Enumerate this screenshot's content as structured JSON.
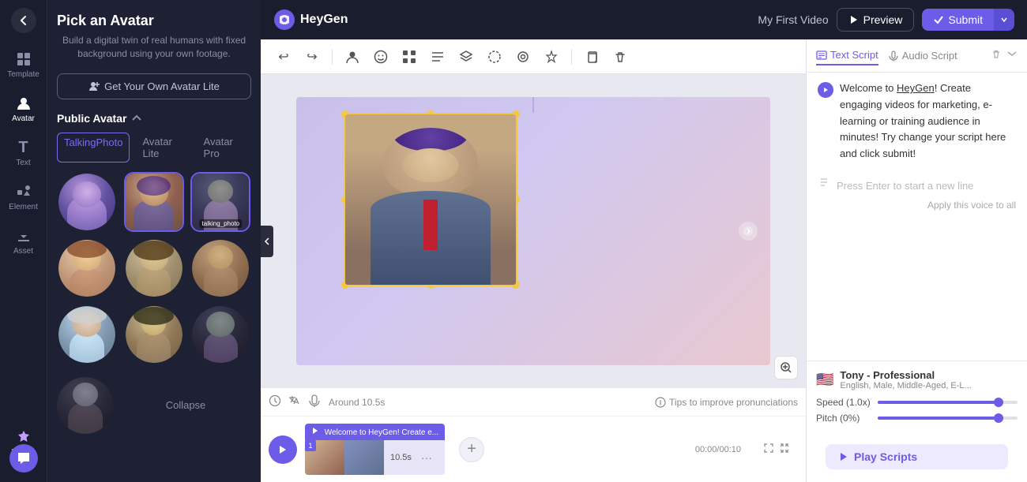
{
  "app": {
    "logo_text": "HeyGen",
    "video_title": "My First Video"
  },
  "header": {
    "preview_label": "Preview",
    "submit_label": "Submit"
  },
  "sidebar": {
    "items": [
      {
        "id": "template",
        "label": "Template",
        "icon": "⊞"
      },
      {
        "id": "avatar",
        "label": "Avatar",
        "icon": "☺"
      },
      {
        "id": "text",
        "label": "Text",
        "icon": "T"
      },
      {
        "id": "element",
        "label": "Element",
        "icon": "✦"
      },
      {
        "id": "asset",
        "label": "Asset",
        "icon": "⬇"
      },
      {
        "id": "pricing",
        "label": "Pricing",
        "icon": "💎"
      }
    ]
  },
  "avatar_panel": {
    "title": "Pick an Avatar",
    "subtitle": "Build a digital twin of real humans with fixed background using your own footage.",
    "get_avatar_btn": "Get Your Own Avatar Lite",
    "public_avatar_title": "Public Avatar",
    "tabs": [
      {
        "id": "talking_photo",
        "label": "TalkingPhoto",
        "active": true
      },
      {
        "id": "avatar_lite",
        "label": "Avatar Lite",
        "active": false
      },
      {
        "id": "avatar_pro",
        "label": "Avatar Pro",
        "active": false
      }
    ],
    "collapse_label": "Collapse"
  },
  "toolbar": {
    "undo": "↩",
    "redo": "↪",
    "person": "👤",
    "emoji": "😊",
    "grid": "⊞",
    "align": "≡",
    "layers": "⧉",
    "mask": "⬡",
    "shape": "◎",
    "magic": "✨",
    "copy": "⧉",
    "delete": "🗑"
  },
  "script": {
    "tabs": [
      {
        "id": "text_script",
        "label": "Text Script",
        "active": true
      },
      {
        "id": "audio_script",
        "label": "Audio Script",
        "active": false
      }
    ],
    "content": "Welcome to HeyGen! Create engaging videos for marketing, e-learning or training audience in minutes! Try change your script here and click submit!",
    "heygen_link": "HeyGen",
    "new_line_placeholder": "Press Enter to start a new line",
    "apply_voice": "Apply this voice to all"
  },
  "voice": {
    "name": "Tony - Professional",
    "desc": "English, Male, Middle-Aged, E-L...",
    "flag": "🇺🇸",
    "speed_label": "Speed (1.0x)",
    "pitch_label": "Pitch (0%)",
    "speed_fill": "90",
    "pitch_fill": "90"
  },
  "timeline": {
    "time_display": "Around 10.5s",
    "tips_label": "Tips to improve pronunciations",
    "play_scripts": "Play Scripts",
    "timestamp": "00:00/00:10",
    "clip_duration": "10.5s",
    "clip_label": "Welcome to HeyGen! Create e...",
    "scene_number": "1"
  },
  "canvas": {
    "zoom_icon": "⊕"
  }
}
